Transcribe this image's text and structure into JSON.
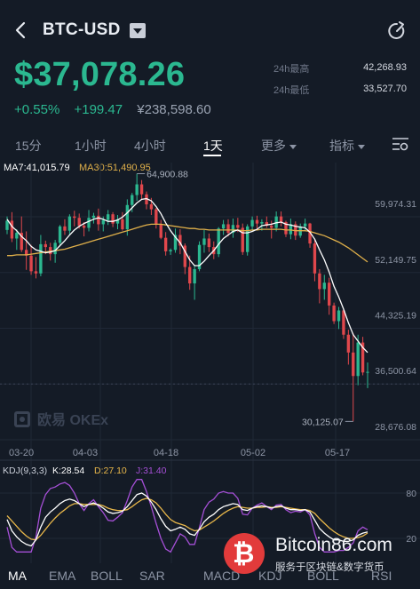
{
  "header": {
    "pair": "BTC-USD"
  },
  "ticker": {
    "price": "$37,078.26",
    "change_pct": "+0.55%",
    "change_abs": "+199.47",
    "price_cny": "¥238,598.60",
    "high_label": "24h最高",
    "high_value": "42,268.93",
    "low_label": "24h最低",
    "low_value": "33,527.70"
  },
  "interval_tabs": [
    {
      "label": "15分"
    },
    {
      "label": "1小时"
    },
    {
      "label": "4小时"
    },
    {
      "label": "1天",
      "active": true
    },
    {
      "label": "更多"
    },
    {
      "label": "指标"
    }
  ],
  "ma_legend": {
    "ma7": "MA7:41,015.79",
    "ma30": "MA30:51,490.95"
  },
  "kdj_legend": {
    "params": "KDJ(9,3,3)",
    "k": "K:28.54",
    "d": "D:27.10",
    "j": "J:31.40"
  },
  "colors": {
    "up": "#2bb890",
    "down": "#e0474c",
    "ma7": "#ffffff",
    "ma30": "#e0b04a",
    "k_line": "#ffffff",
    "d_line": "#e8b74a",
    "j_line": "#a54fd6",
    "background": "#141b26"
  },
  "watermarks": {
    "exchange": "欧易 OKEx",
    "site": "Bitcoin86.com",
    "site_sub": "服务于区块链&数字货币"
  },
  "indicator_tabs": [
    {
      "label": "MA",
      "active": true
    },
    {
      "label": "EMA"
    },
    {
      "label": "BOLL"
    },
    {
      "label": "SAR"
    },
    {
      "label": "MACD"
    },
    {
      "label": "KDJ"
    },
    {
      "label": "BOLL"
    },
    {
      "label": "RSI"
    }
  ],
  "chart_data": {
    "type": "candlestick",
    "x_tick_labels": [
      "03-20",
      "04-03",
      "04-18",
      "05-02",
      "05-17"
    ],
    "y_tick_labels": [
      "59,974.31",
      "52,149.75",
      "44,325.19",
      "36,500.64",
      "28,676.08"
    ],
    "ylim": [
      28676.08,
      59974.31
    ],
    "max_label": "64,900.88",
    "min_label": "30,125.07",
    "kdj_ticks": [
      "80",
      "20"
    ],
    "candles": [
      [
        57000,
        58900,
        56400,
        58300
      ],
      [
        58300,
        59500,
        55300,
        55800
      ],
      [
        55800,
        57100,
        54200,
        56600
      ],
      [
        56600,
        58900,
        53900,
        54200
      ],
      [
        54200,
        56800,
        51400,
        53400
      ],
      [
        53400,
        54900,
        50700,
        51200
      ],
      [
        51200,
        53200,
        50200,
        50900
      ],
      [
        50900,
        56300,
        50500,
        55000
      ],
      [
        55000,
        55500,
        53600,
        54600
      ],
      [
        54600,
        55200,
        52700,
        53600
      ],
      [
        53600,
        55600,
        52400,
        55200
      ],
      [
        55200,
        57700,
        54700,
        57500
      ],
      [
        57500,
        58500,
        56300,
        56900
      ],
      [
        56900,
        59200,
        56300,
        58900
      ],
      [
        58900,
        59700,
        57500,
        58700
      ],
      [
        58700,
        59300,
        57200,
        57600
      ],
      [
        57600,
        58100,
        56100,
        57300
      ],
      [
        57300,
        59800,
        56800,
        58700
      ],
      [
        58700,
        59400,
        57900,
        59000
      ],
      [
        59000,
        60000,
        56900,
        57800
      ],
      [
        57800,
        58900,
        56800,
        58400
      ],
      [
        58400,
        59800,
        57700,
        59200
      ],
      [
        59200,
        59500,
        57400,
        57900
      ],
      [
        57900,
        59100,
        57100,
        58500
      ],
      [
        58500,
        59500,
        56900,
        57100
      ],
      [
        57100,
        61300,
        56200,
        60500
      ],
      [
        60500,
        62200,
        59500,
        61900
      ],
      [
        61900,
        64900,
        61100,
        63400
      ],
      [
        63400,
        64000,
        61200,
        62000
      ],
      [
        62000,
        62400,
        59900,
        60600
      ],
      [
        60600,
        61500,
        59100,
        59900
      ],
      [
        59900,
        60100,
        57200,
        57800
      ],
      [
        57800,
        58400,
        55700,
        55900
      ],
      [
        55900,
        56700,
        53400,
        54000
      ],
      [
        54000,
        54400,
        53500,
        54200
      ],
      [
        54200,
        57200,
        53800,
        56300
      ],
      [
        56300,
        57100,
        53600,
        54800
      ],
      [
        54800,
        55100,
        50800,
        51800
      ],
      [
        51800,
        53400,
        48600,
        49500
      ],
      [
        49500,
        52100,
        47200,
        51500
      ],
      [
        51500,
        55400,
        51200,
        54900
      ],
      [
        54900,
        57000,
        53800,
        55800
      ],
      [
        55800,
        56500,
        53900,
        54600
      ],
      [
        54600,
        55400,
        52900,
        53600
      ],
      [
        53600,
        57400,
        53200,
        57200
      ],
      [
        57200,
        58400,
        56300,
        57800
      ],
      [
        57800,
        58500,
        56100,
        56600
      ],
      [
        56600,
        58600,
        55900,
        57700
      ],
      [
        57700,
        58700,
        56700,
        57300
      ],
      [
        57300,
        57900,
        53500,
        53900
      ],
      [
        53900,
        57800,
        53400,
        57500
      ],
      [
        57500,
        58900,
        56900,
        58400
      ],
      [
        58400,
        59000,
        57200,
        57900
      ],
      [
        57900,
        58500,
        56900,
        58100
      ],
      [
        58100,
        58900,
        57300,
        57600
      ],
      [
        57600,
        58300,
        55800,
        57300
      ],
      [
        57300,
        59600,
        56800,
        58900
      ],
      [
        58900,
        59600,
        57500,
        58100
      ],
      [
        58100,
        58300,
        56000,
        56400
      ],
      [
        56400,
        58600,
        55700,
        57800
      ],
      [
        57800,
        58200,
        55600,
        56200
      ],
      [
        56200,
        57900,
        55900,
        57500
      ],
      [
        57500,
        58600,
        56800,
        57900
      ],
      [
        57900,
        58000,
        54500,
        55100
      ],
      [
        55100,
        55600,
        49800,
        50900
      ],
      [
        50900,
        51500,
        46700,
        48700
      ],
      [
        48700,
        50700,
        47200,
        49600
      ],
      [
        49600,
        50300,
        45100,
        46400
      ],
      [
        46400,
        46800,
        43800,
        44200
      ],
      [
        44200,
        46200,
        43100,
        45700
      ],
      [
        45700,
        45900,
        41700,
        42300
      ],
      [
        42300,
        43000,
        38100,
        39800
      ],
      [
        39800,
        42500,
        30125,
        36500
      ],
      [
        36500,
        42300,
        35200,
        41200
      ],
      [
        41200,
        42000,
        36600,
        37000
      ],
      [
        37000,
        38400,
        34800,
        37078
      ]
    ],
    "ma7": [
      58500,
      57500,
      56900,
      56100,
      55500,
      54700,
      54200,
      54000,
      53800,
      53900,
      54100,
      54800,
      55500,
      56300,
      57000,
      57500,
      57900,
      58200,
      58500,
      58700,
      58500,
      58200,
      58200,
      58400,
      58800,
      59400,
      60100,
      60800,
      61300,
      61400,
      61100,
      60300,
      59300,
      58000,
      56900,
      56000,
      55200,
      54000,
      52800,
      52000,
      52000,
      52600,
      53400,
      54100,
      55000,
      55800,
      56300,
      56800,
      57000,
      56600,
      56600,
      56800,
      57100,
      57600,
      57700,
      57800,
      58000,
      58100,
      57800,
      57700,
      57500,
      57400,
      57300,
      56700,
      55700,
      54200,
      52800,
      51100,
      49100,
      47600,
      45900,
      44000,
      42300,
      41400,
      40500,
      39800
    ],
    "ma30": [
      53400,
      53400,
      53500,
      53500,
      53500,
      53600,
      53700,
      53800,
      53900,
      54000,
      54100,
      54200,
      54300,
      54500,
      54700,
      54900,
      55100,
      55300,
      55500,
      55700,
      55900,
      56100,
      56300,
      56500,
      56700,
      56900,
      57100,
      57300,
      57500,
      57700,
      57800,
      57800,
      57800,
      57700,
      57600,
      57500,
      57400,
      57300,
      57200,
      57200,
      57100,
      57100,
      57000,
      57000,
      57000,
      57000,
      57000,
      57000,
      57000,
      56900,
      56900,
      57000,
      57000,
      57100,
      57100,
      57100,
      57100,
      57100,
      57000,
      57000,
      56900,
      56900,
      56900,
      56800,
      56600,
      56400,
      56200,
      55900,
      55600,
      55300,
      54900,
      54500,
      54000,
      53500,
      53000,
      52500
    ],
    "kdj": {
      "k": [
        45,
        30,
        22,
        16,
        12,
        10,
        18,
        35,
        48,
        55,
        60,
        66,
        70,
        72,
        70,
        66,
        62,
        65,
        67,
        64,
        60,
        55,
        53,
        54,
        56,
        62,
        70,
        78,
        80,
        76,
        68,
        58,
        46,
        36,
        30,
        32,
        35,
        32,
        26,
        24,
        32,
        42,
        48,
        52,
        58,
        62,
        64,
        66,
        65,
        58,
        57,
        60,
        62,
        63,
        62,
        60,
        62,
        63,
        60,
        58,
        58,
        57,
        58,
        55,
        44,
        33,
        27,
        22,
        18,
        18,
        16,
        16,
        18,
        24,
        27,
        28.54
      ],
      "d": [
        50,
        43,
        36,
        29,
        23,
        19,
        18,
        24,
        32,
        40,
        47,
        53,
        58,
        63,
        66,
        66,
        65,
        65,
        65,
        65,
        63,
        60,
        58,
        57,
        57,
        58,
        62,
        67,
        71,
        73,
        71,
        67,
        60,
        52,
        45,
        41,
        39,
        37,
        33,
        30,
        31,
        35,
        39,
        43,
        48,
        53,
        57,
        60,
        62,
        61,
        60,
        60,
        61,
        61,
        62,
        61,
        61,
        62,
        61,
        60,
        59,
        58,
        58,
        57,
        53,
        46,
        40,
        34,
        29,
        25,
        22,
        20,
        20,
        21,
        23,
        27.1
      ],
      "j": [
        35,
        8,
        2,
        2,
        2,
        2,
        22,
        60,
        78,
        86,
        88,
        92,
        94,
        90,
        80,
        66,
        57,
        66,
        71,
        62,
        54,
        44,
        43,
        48,
        54,
        70,
        88,
        98,
        98,
        82,
        62,
        40,
        20,
        6,
        2,
        14,
        26,
        22,
        12,
        12,
        34,
        58,
        68,
        72,
        80,
        82,
        80,
        80,
        73,
        52,
        51,
        60,
        64,
        67,
        62,
        58,
        64,
        65,
        58,
        54,
        56,
        55,
        58,
        51,
        26,
        8,
        2,
        2,
        2,
        4,
        4,
        8,
        14,
        30,
        35,
        31.4
      ]
    }
  }
}
